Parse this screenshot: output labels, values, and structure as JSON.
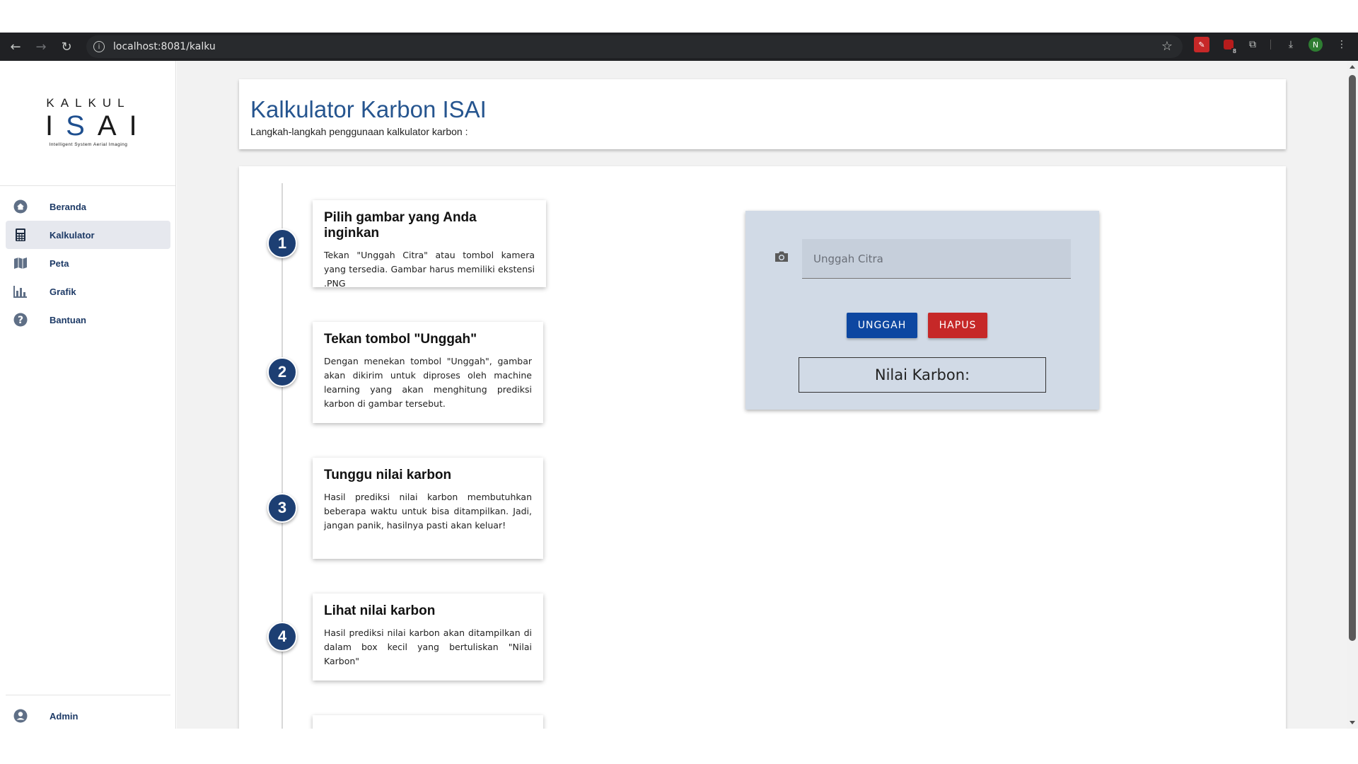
{
  "browser": {
    "url": "localhost:8081/kalku",
    "profile_initial": "N",
    "ext_badge": "8"
  },
  "sidebar": {
    "logo_top": "KALKUL",
    "logo_main_1": "I",
    "logo_main_s": "S",
    "logo_main_2": "AI",
    "logo_tagline": "Intelligent System Aerial Imaging",
    "items": [
      {
        "label": "Beranda",
        "icon": "home-icon"
      },
      {
        "label": "Kalkulator",
        "icon": "calculator-icon"
      },
      {
        "label": "Peta",
        "icon": "map-icon"
      },
      {
        "label": "Grafik",
        "icon": "chart-icon"
      },
      {
        "label": "Bantuan",
        "icon": "help-icon"
      }
    ],
    "admin_label": "Admin"
  },
  "header": {
    "title": "Kalkulator Karbon ISAI",
    "subtitle": "Langkah-langkah penggunaan kalkulator karbon :"
  },
  "steps": [
    {
      "num": "1",
      "title": "Pilih gambar yang Anda inginkan",
      "desc": "Tekan \"Unggah Citra\" atau tombol kamera yang tersedia. Gambar harus memiliki ekstensi .PNG"
    },
    {
      "num": "2",
      "title": "Tekan tombol \"Unggah\"",
      "desc": "Dengan menekan tombol \"Unggah\", gambar akan dikirim untuk diproses oleh machine learning yang akan menghitung prediksi karbon di gambar tersebut."
    },
    {
      "num": "3",
      "title": "Tunggu nilai karbon",
      "desc": "Hasil prediksi nilai karbon membutuhkan beberapa waktu untuk bisa ditampilkan. Jadi, jangan panik, hasilnya pasti akan keluar!"
    },
    {
      "num": "4",
      "title": "Lihat nilai karbon",
      "desc": "Hasil prediksi nilai karbon akan ditampilkan di dalam box kecil yang bertuliskan \"Nilai Karbon\""
    }
  ],
  "upload": {
    "placeholder": "Unggah Citra",
    "unggah_label": "UNGGAH",
    "hapus_label": "HAPUS",
    "nilai_label": "Nilai Karbon:"
  }
}
